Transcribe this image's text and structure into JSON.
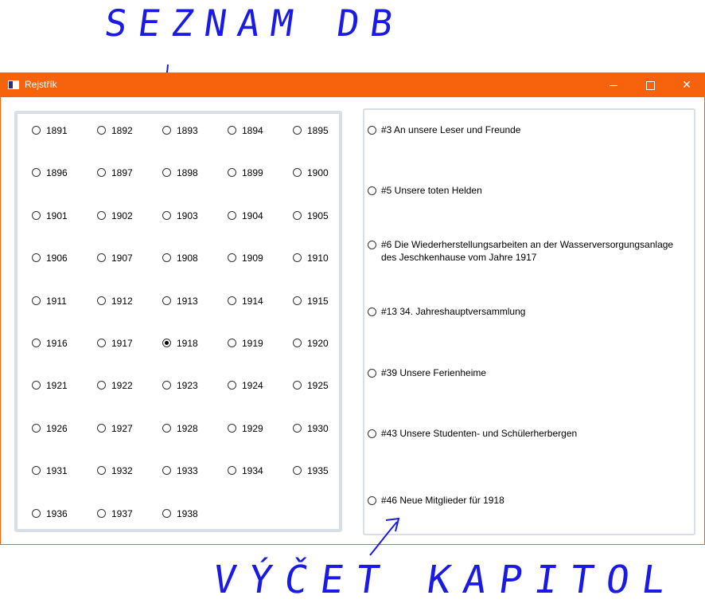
{
  "annotations": {
    "top": "SEZNAM DB",
    "bottom": "VÝČET KAPITOL"
  },
  "window": {
    "title": "Rejstřík",
    "icon": "app-window-icon",
    "controls": [
      "minimize-icon",
      "maximize-icon",
      "close-icon"
    ],
    "close_glyph": "✕",
    "accent_color": "#f7630c"
  },
  "years": {
    "selected": "1918",
    "items": [
      "1891",
      "1892",
      "1893",
      "1894",
      "1895",
      "1896",
      "1897",
      "1898",
      "1899",
      "1900",
      "1901",
      "1902",
      "1903",
      "1904",
      "1905",
      "1906",
      "1907",
      "1908",
      "1909",
      "1910",
      "1911",
      "1912",
      "1913",
      "1914",
      "1915",
      "1916",
      "1917",
      "1918",
      "1919",
      "1920",
      "1921",
      "1922",
      "1923",
      "1924",
      "1925",
      "1926",
      "1927",
      "1928",
      "1929",
      "1930",
      "1931",
      "1932",
      "1933",
      "1934",
      "1935",
      "1936",
      "1937",
      "1938"
    ]
  },
  "chapters": {
    "items": [
      "#3 An unsere Leser und Freunde",
      "#5 Unsere toten Helden",
      "#6 Die Wiederherstellungsarbeiten an der Wasserversorgungsanlage des Jeschkenhause vom Jahre 1917",
      "#13 34. Jahreshauptversammlung",
      "#39 Unsere Ferienheime",
      "#43 Unsere Studenten- und Schülerherbergen",
      "#46 Neue Mitglieder für 1918"
    ]
  }
}
